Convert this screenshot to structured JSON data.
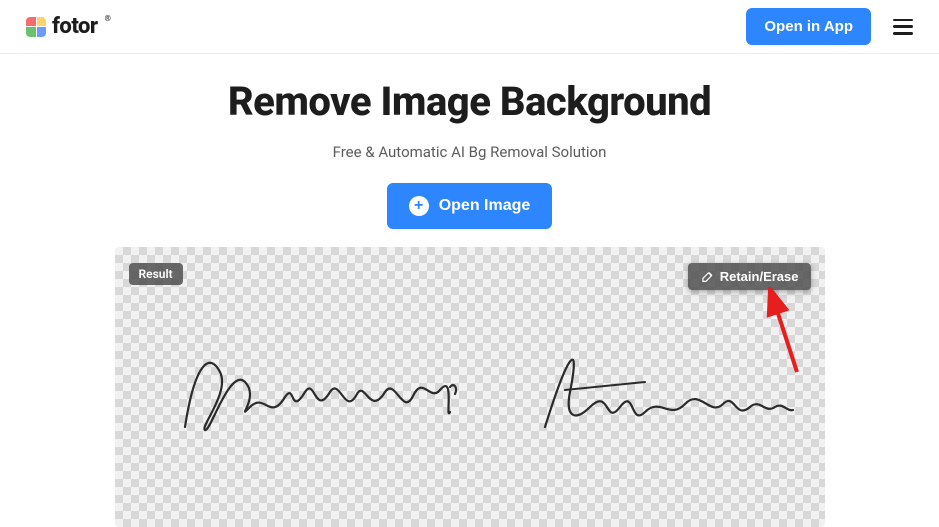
{
  "header": {
    "logo_text": "fotor",
    "open_app_label": "Open in App"
  },
  "main": {
    "title": "Remove Image Background",
    "subtitle": "Free & Automatic AI Bg Removal Solution",
    "open_image_label": "Open Image"
  },
  "canvas": {
    "result_badge": "Result",
    "retain_erase_label": "Retain/Erase"
  }
}
